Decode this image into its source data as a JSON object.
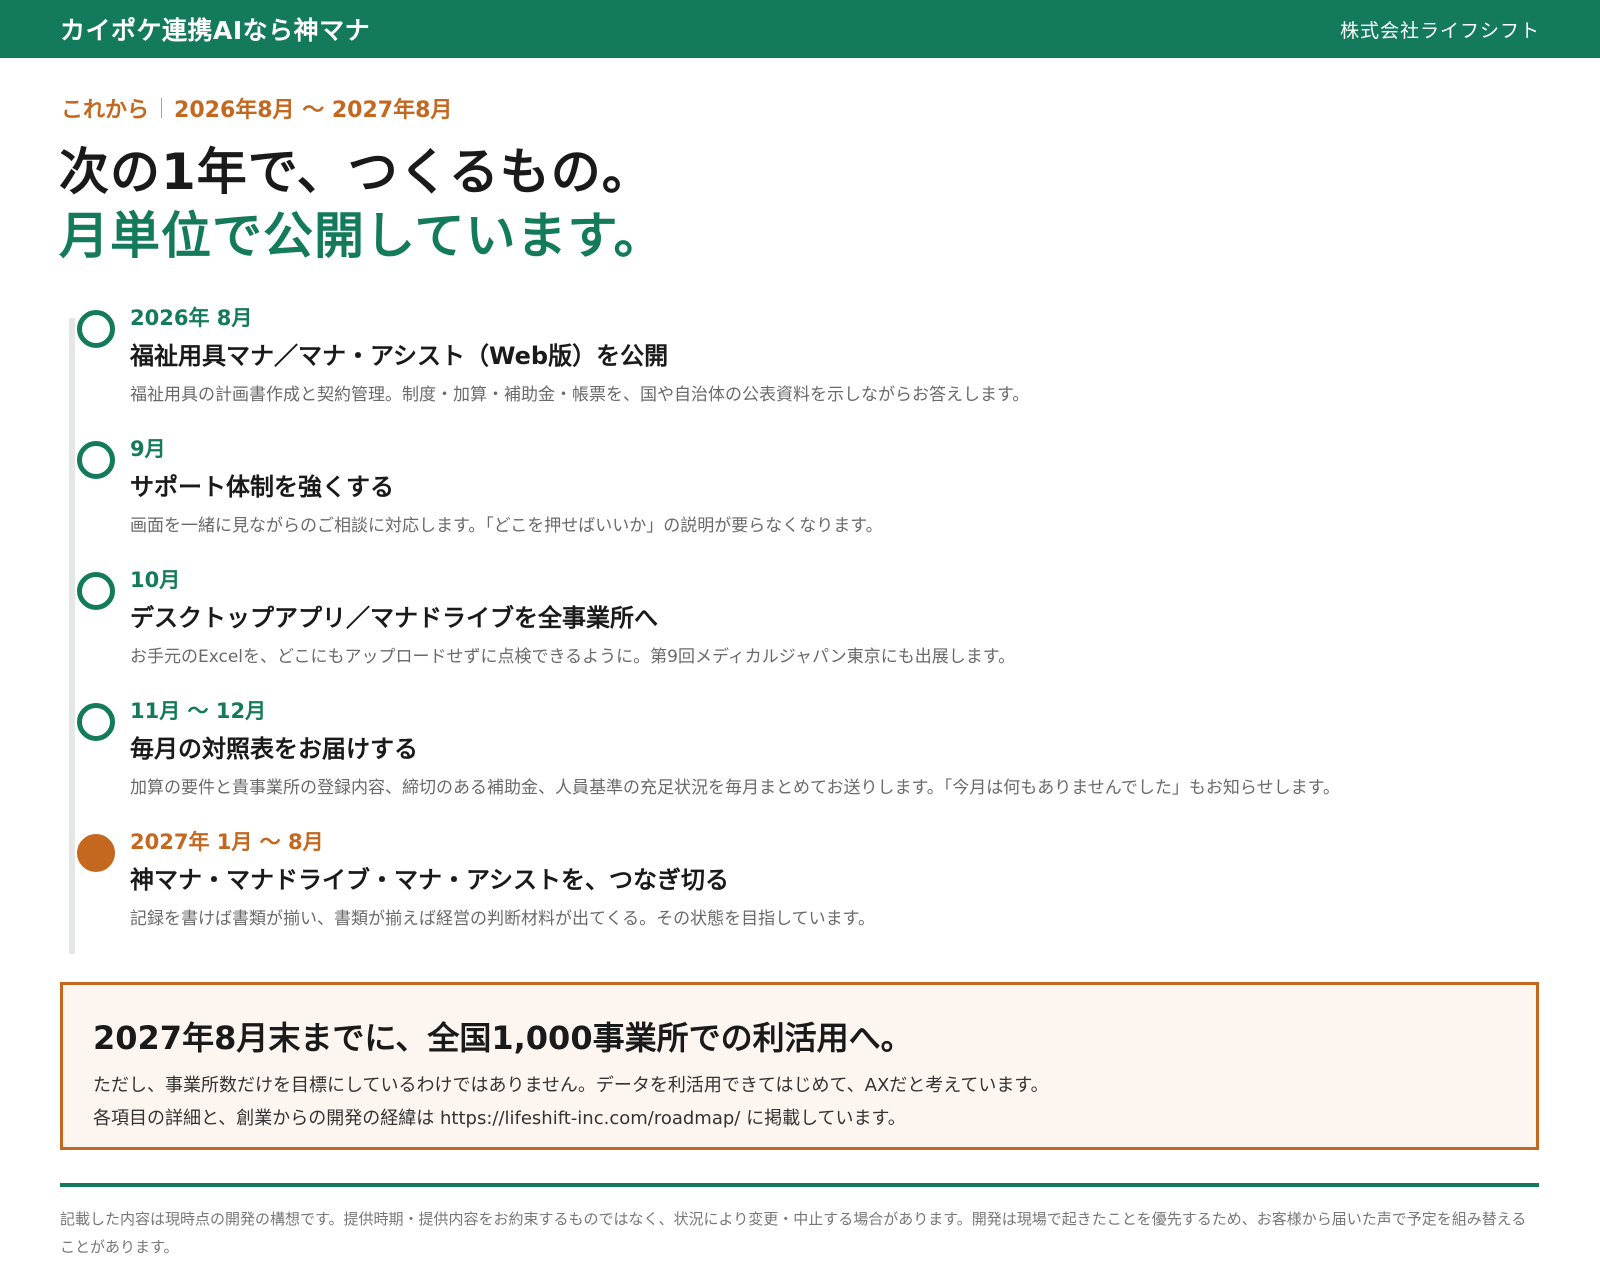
{
  "header": {
    "brand": "カイポケ連携AIなら神マナ",
    "company": "株式会社ライフシフト"
  },
  "intro": {
    "kicker_label": "これから",
    "kicker_period": "2026年8月 〜 2027年8月",
    "headline_line1": "次の1年で、つくるもの。",
    "headline_line2": "月単位で公開しています。"
  },
  "timeline": [
    {
      "date": "2026年 8月",
      "title": "福祉用具マナ／マナ・アシスト（Web版）を公開",
      "desc": "福祉用具の計画書作成と契約管理。制度・加算・補助金・帳票を、国や自治体の公表資料を示しながらお答えします。",
      "status": "planned"
    },
    {
      "date": "9月",
      "title": "サポート体制を強くする",
      "desc": "画面を一緒に見ながらのご相談に対応します。「どこを押せばいいか」の説明が要らなくなります。",
      "status": "planned"
    },
    {
      "date": "10月",
      "title": "デスクトップアプリ／マナドライブを全事業所へ",
      "desc": "お手元のExcelを、どこにもアップロードせずに点検できるように。第9回メディカルジャパン東京にも出展します。",
      "status": "planned"
    },
    {
      "date": "11月 〜 12月",
      "title": "毎月の対照表をお届けする",
      "desc": "加算の要件と貴事業所の登録内容、締切のある補助金、人員基準の充足状況を毎月まとめてお送りします。「今月は何もありませんでした」もお知らせします。",
      "status": "planned"
    },
    {
      "date": "2027年 1月 〜 8月",
      "title": "神マナ・マナドライブ・マナ・アシストを、つなぎ切る",
      "desc": "記録を書けば書類が揃い、書類が揃えば経営の判断材料が出てくる。その状態を目指しています。",
      "status": "goal"
    }
  ],
  "goal": {
    "title": "2027年8月末までに、全国1,000事業所での利活用へ。",
    "line1": "ただし、事業所数だけを目標にしているわけではありません。データを利活用できてはじめて、AXだと考えています。",
    "line2": "各項目の詳細と、創業からの開発の経緯は https://lifeshift-inc.com/roadmap/ に掲載しています。"
  },
  "footnote": "記載した内容は現時点の開発の構想です。提供時期・提供内容をお約束するものではなく、状況により変更・中止する場合があります。開発は現場で起きたことを優先するため、お客様から届いた声で予定を組み替えることがあります。",
  "colors": {
    "brand_green": "#137a5c",
    "accent_orange": "#c4671f"
  }
}
